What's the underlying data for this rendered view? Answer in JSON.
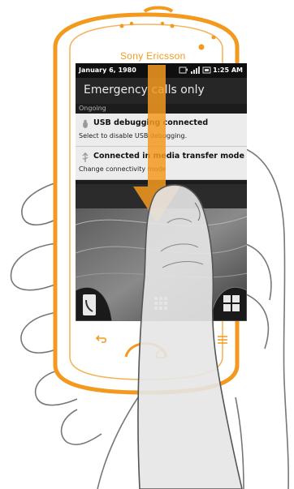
{
  "phone": {
    "brand": "Sony Ericsson"
  },
  "status_bar": {
    "date": "January 6, 1980",
    "time": "1:25 AM",
    "icons": [
      "data-transfer-icon",
      "signal-icon",
      "battery-icon"
    ]
  },
  "notification_panel": {
    "carrier_text": "Emergency calls only",
    "section_label": "Ongoing",
    "notifications": [
      {
        "title": "USB debugging connected",
        "subtitle": "Select to disable USB debugging.",
        "icon": "usb-bug-icon"
      },
      {
        "title": "Connected in media transfer mode",
        "subtitle": "Change connectivity mode",
        "icon": "usb-icon"
      }
    ]
  },
  "dock": {
    "items": [
      "phone-icon",
      "app-grid-icon",
      "apps-corner-icon"
    ]
  },
  "hardware_keys": [
    "back-key-icon",
    "home-key-icon",
    "menu-key-icon"
  ],
  "gesture": {
    "direction": "down",
    "icon": "swipe-down-arrow-icon"
  },
  "colors": {
    "phone_orange": "#f39a1e",
    "screen_dark": "#1c1c1c",
    "notification_bg": "#ececec"
  }
}
